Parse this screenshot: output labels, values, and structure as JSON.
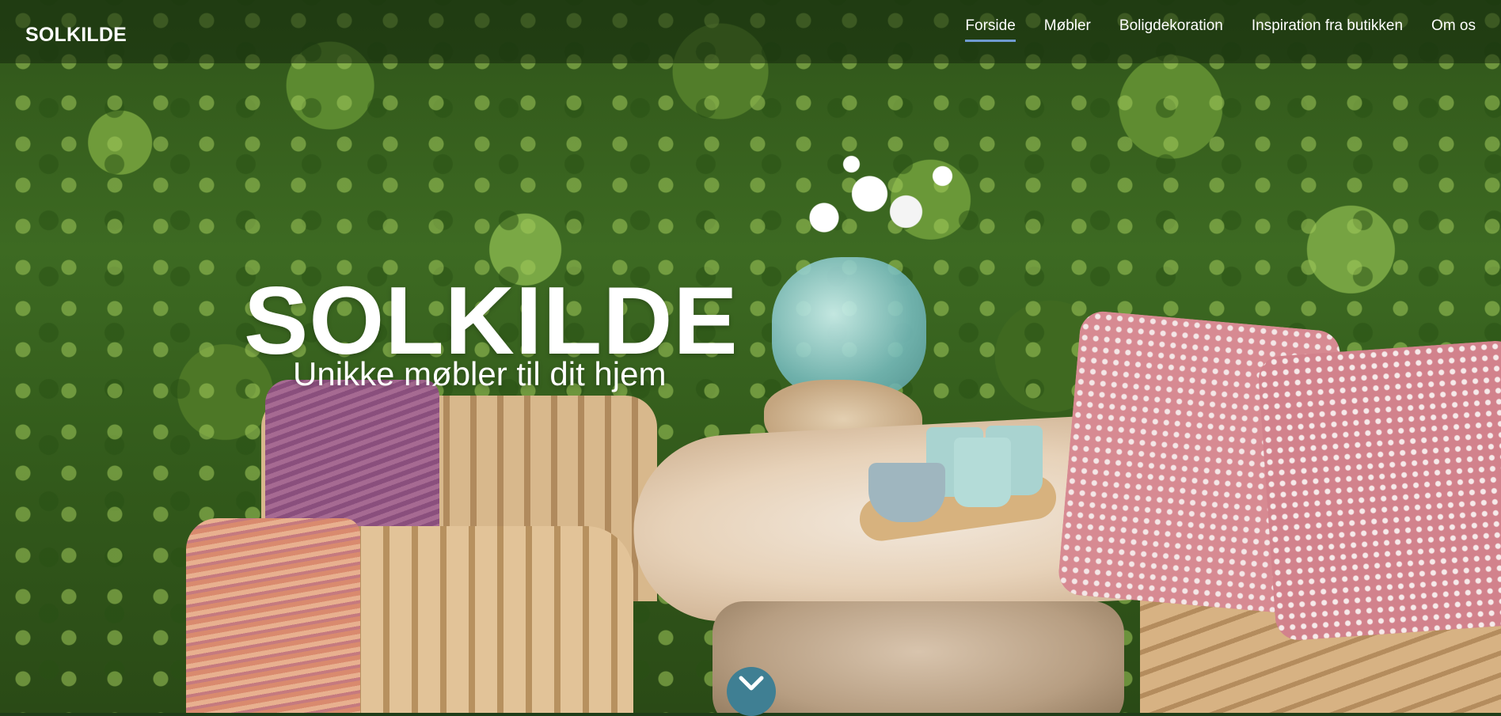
{
  "brand": {
    "name": "SOLKILDE"
  },
  "nav": {
    "items": [
      {
        "label": "Forside",
        "active": true
      },
      {
        "label": "Møbler",
        "active": false
      },
      {
        "label": "Boligdekoration",
        "active": false
      },
      {
        "label": "Inspiration fra butikken",
        "active": false
      },
      {
        "label": "Om os",
        "active": false
      }
    ]
  },
  "hero": {
    "title": "SOLKILDE",
    "subtitle": "Unikke møbler til dit hjem",
    "scroll_icon": "chevron-down-icon"
  },
  "colors": {
    "nav_active_underline": "#6f9bd0",
    "scroll_button": "#3f7f93",
    "text": "#ffffff"
  }
}
